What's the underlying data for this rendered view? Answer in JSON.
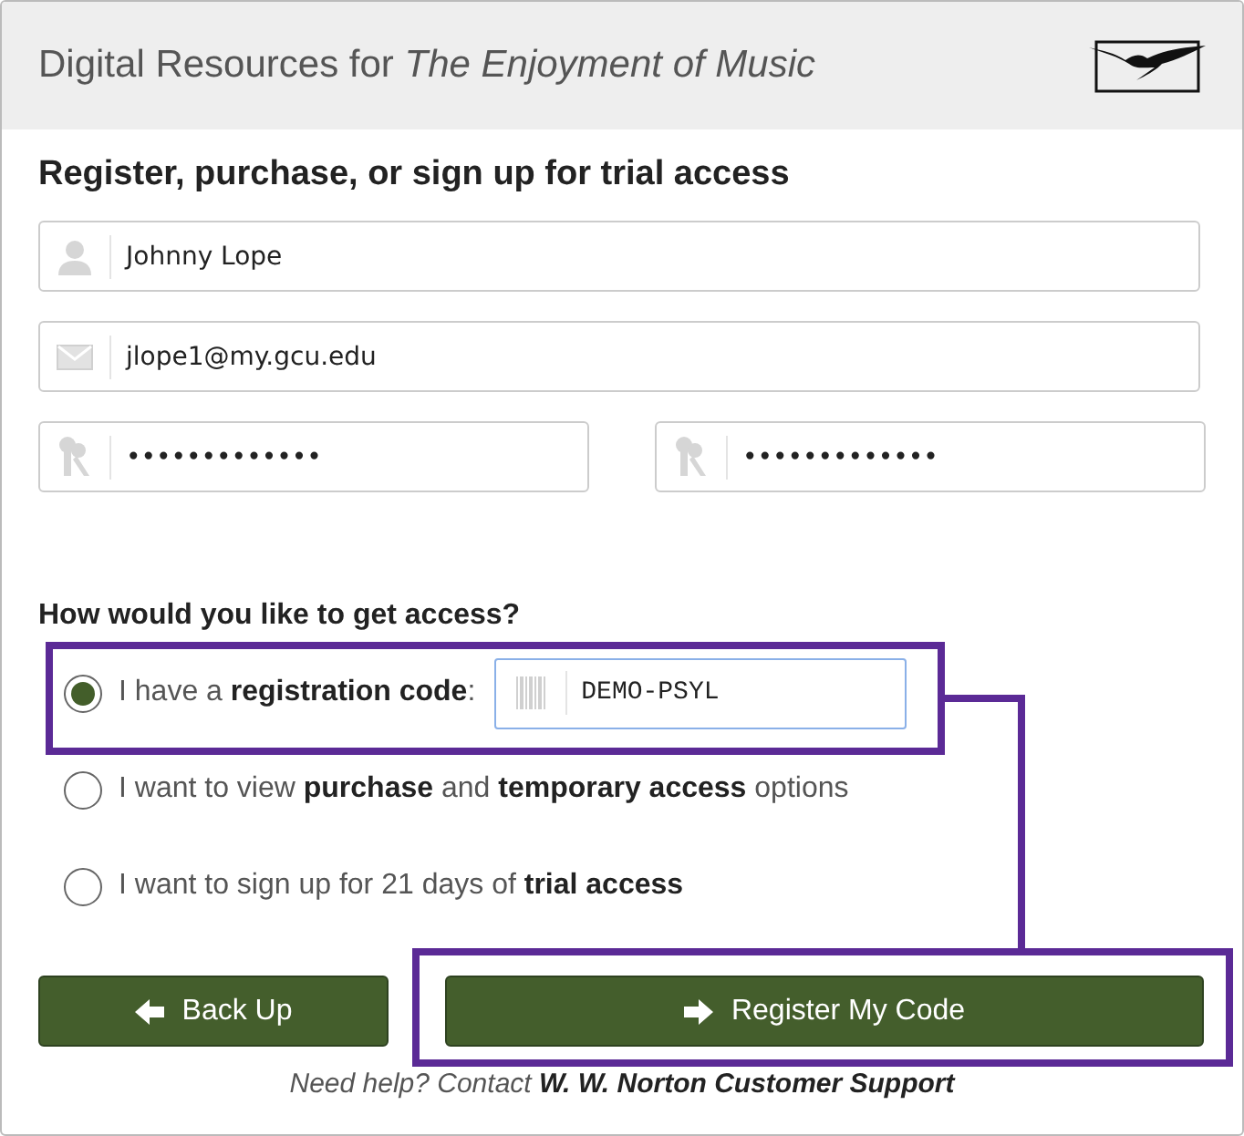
{
  "header": {
    "title": "Digital Resources for *The Enjoyment of Music*"
  },
  "heading": "Register, purchase, or sign up for trial access",
  "fields": [
    {
      "kind": "person",
      "value": "Johnny Lope"
    },
    {
      "kind": "email",
      "value": "jlope1@my.gcu.edu"
    },
    {
      "kind": "password",
      "value": "•••••••••••••"
    },
    {
      "kind": "password",
      "value": "•••••••••••••"
    }
  ],
  "access": {
    "question": "How would you like to get access?",
    "options": [
      {
        "label": "I have a **registration code**:",
        "selected": true,
        "code": "DEMO-PSYL"
      },
      {
        "label": "I want to view **purchase** and **temporary access** options",
        "selected": false
      },
      {
        "label": "I want to sign up for 21 days of **trial access**",
        "selected": false
      }
    ]
  },
  "buttons": [
    {
      "kind": "back",
      "label": "Back Up"
    },
    {
      "kind": "forward",
      "label": "Register My Code"
    }
  ],
  "help": {
    "text": "Need help? Contact ",
    "link": "W. W. Norton Customer Support"
  },
  "annotation": {
    "color": "#5b2a96"
  }
}
